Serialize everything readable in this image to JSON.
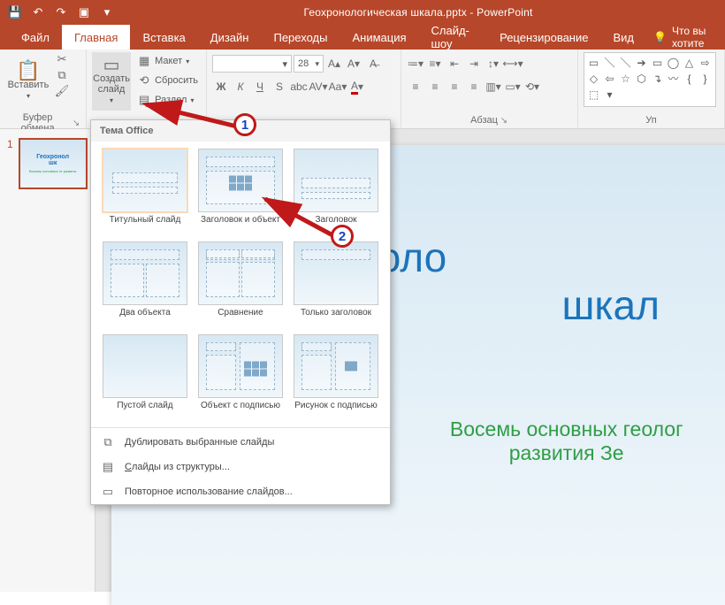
{
  "app": {
    "title": "Геохронологическая шкала.pptx - PowerPoint"
  },
  "qat": {
    "save": "save-icon",
    "undo": "undo-icon",
    "redo": "redo-icon",
    "start": "start-from-beginning-icon",
    "customize": "customize-qat-icon"
  },
  "tabs": {
    "file": "Файл",
    "home": "Главная",
    "insert": "Вставка",
    "design": "Дизайн",
    "transitions": "Переходы",
    "animations": "Анимация",
    "slideshow": "Слайд-шоу",
    "review": "Рецензирование",
    "view": "Вид"
  },
  "tell_me": {
    "placeholder": "Что вы хотите"
  },
  "ribbon": {
    "clipboard": {
      "paste": "Вставить",
      "label": "Буфер обмена"
    },
    "slides": {
      "new_slide": "Создать слайд",
      "layout": "Макет",
      "reset": "Сбросить",
      "section": "Раздел"
    },
    "font": {
      "size": "28"
    },
    "paragraph": {
      "label": "Абзац"
    },
    "editing": {
      "label": "Уп"
    }
  },
  "dropdown": {
    "header": "Тема Office",
    "layouts": [
      {
        "key": "title",
        "label": "Титульный слайд"
      },
      {
        "key": "title_content",
        "label": "Заголовок и объект"
      },
      {
        "key": "section_header",
        "label": "Заголовок"
      },
      {
        "key": "two_content",
        "label": "Два объекта"
      },
      {
        "key": "comparison",
        "label": "Сравнение"
      },
      {
        "key": "title_only",
        "label": "Только заголовок"
      },
      {
        "key": "blank",
        "label": "Пустой слайд"
      },
      {
        "key": "obj_caption",
        "label": "Объект с подписью"
      },
      {
        "key": "pic_caption",
        "label": "Рисунок с подписью"
      }
    ],
    "dup": "Дублировать выбранные слайды",
    "outline": "Слайды из структуры...",
    "reuse": "Повторное использование слайдов..."
  },
  "slide": {
    "title": "Геохроноло",
    "title2": "шкал",
    "subtitle": "Восемь основных геолог",
    "subtitle2": "развития Зе"
  },
  "thumb": {
    "num": "1",
    "t1a": "Геохронол",
    "t1b": "шк",
    "t2": "Восемь основных ге\nразвити"
  },
  "annot": {
    "n1": "1",
    "n2": "2"
  }
}
